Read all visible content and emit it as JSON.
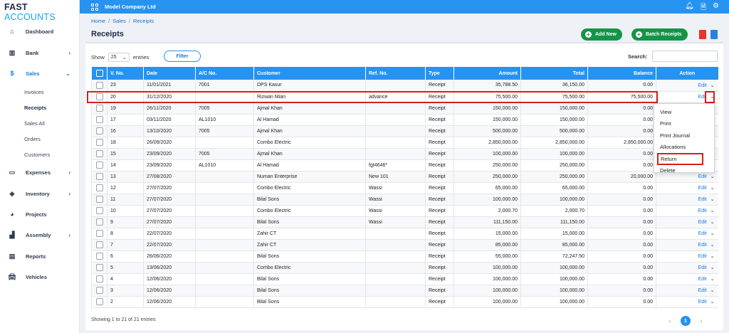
{
  "brand": {
    "part1": "FAST",
    "part2": "ACCOUNTS"
  },
  "topbar": {
    "company": "Model Company Ltd"
  },
  "sidebar": {
    "items": [
      {
        "label": "Dashboard",
        "icon": "home-icon"
      },
      {
        "label": "Bank",
        "icon": "bank-icon"
      },
      {
        "label": "Sales",
        "icon": "dollar-icon"
      },
      {
        "label": "Expenses",
        "icon": "money-icon"
      },
      {
        "label": "Inventory",
        "icon": "cubes-icon"
      },
      {
        "label": "Projects",
        "icon": "pie-chart-icon"
      },
      {
        "label": "Assembly",
        "icon": "bar-chart-icon"
      },
      {
        "label": "Reports",
        "icon": "reports-icon"
      },
      {
        "label": "Vehicles",
        "icon": "car-icon"
      }
    ],
    "sales_sub": [
      "Invoices",
      "Receipts",
      "Sales All",
      "Orders",
      "Customers"
    ]
  },
  "breadcrumb": [
    "Home",
    "Sales",
    "Receipts"
  ],
  "page_title": "Receipts",
  "buttons": {
    "add_new": "Add New",
    "batch_receipts": "Batch Receipts",
    "filter": "Filter"
  },
  "controls": {
    "show": "Show",
    "entries_value": "25",
    "entries": "entries",
    "search": "Search:"
  },
  "table": {
    "headers": [
      "V. No.",
      "Date",
      "A/C No.",
      "Customer",
      "Ref. No.",
      "Type",
      "Amount",
      "Total",
      "Balance",
      "Action"
    ],
    "rows": [
      [
        "23",
        "11/01/2021",
        "7001",
        "DPS Kasur",
        "",
        "Receipt",
        "35,788.50",
        "36,150.00",
        "0.00",
        "edit"
      ],
      [
        "20",
        "31/12/2020",
        "",
        "Rizwan Mian",
        "advance",
        "Receipt",
        "75,500.00",
        "75,500.00",
        "75,500.00",
        "edit"
      ],
      [
        "19",
        "26/11/2020",
        "7005",
        "Ajmal Khan",
        "",
        "Receipt",
        "150,000.00",
        "150,000.00",
        "0.00",
        ""
      ],
      [
        "17",
        "03/11/2020",
        "AL1010",
        "Al Hamad",
        "",
        "Receipt",
        "150,000.00",
        "150,000.00",
        "0.00",
        ""
      ],
      [
        "16",
        "13/10/2020",
        "7005",
        "Ajmal Khan",
        "",
        "Receipt",
        "500,000.00",
        "500,000.00",
        "0.00",
        ""
      ],
      [
        "18",
        "26/09/2020",
        "",
        "Combo Electric",
        "",
        "Receipt",
        "2,850,000.00",
        "2,850,000.00",
        "2,850,000.00",
        ""
      ],
      [
        "15",
        "23/09/2020",
        "7005",
        "Ajmal Khan",
        "",
        "Receipt",
        "100,000.00",
        "100,000.00",
        "0.00",
        ""
      ],
      [
        "14",
        "23/09/2020",
        "AL1010",
        "Al Hamad",
        "fgt4646*",
        "Receipt",
        "250,000.00",
        "250,000.00",
        "0.00",
        ""
      ],
      [
        "13",
        "27/08/2020",
        "",
        "Numan Enterprise",
        "New 101",
        "Receipt",
        "250,000.00",
        "250,000.00",
        "20,000.00",
        "edit"
      ],
      [
        "12",
        "27/07/2020",
        "",
        "Combo Electric",
        "Wassi",
        "Receipt",
        "65,000.00",
        "65,000.00",
        "0.00",
        "edit"
      ],
      [
        "11",
        "27/07/2020",
        "",
        "Bilal Sons",
        "Wassi",
        "Receipt",
        "100,000.00",
        "100,000.00",
        "0.00",
        "edit"
      ],
      [
        "10",
        "27/07/2020",
        "",
        "Combo Electric",
        "Wassi",
        "Receipt",
        "2,000.70",
        "2,000.70",
        "0.00",
        "edit"
      ],
      [
        "9",
        "27/07/2020",
        "",
        "Bilal Sons",
        "Wassi",
        "Receipt",
        "111,150.00",
        "111,150.00",
        "0.00",
        "edit"
      ],
      [
        "8",
        "22/07/2020",
        "",
        "Zahir CT",
        "",
        "Receipt",
        "15,000.00",
        "15,000.00",
        "0.00",
        "edit"
      ],
      [
        "7",
        "22/07/2020",
        "",
        "Zahir CT",
        "",
        "Receipt",
        "85,000.00",
        "85,000.00",
        "0.00",
        "edit"
      ],
      [
        "6",
        "26/06/2020",
        "",
        "Bilal Sons",
        "",
        "Receipt",
        "55,000.00",
        "72,247.50",
        "0.00",
        "edit"
      ],
      [
        "5",
        "13/06/2020",
        "",
        "Combo Electric",
        "",
        "Receipt",
        "100,000.00",
        "100,000.00",
        "0.00",
        "edit"
      ],
      [
        "4",
        "12/06/2020",
        "",
        "Bilal Sons",
        "",
        "Receipt",
        "100,000.00",
        "100,000.00",
        "0.00",
        "edit"
      ],
      [
        "3",
        "12/06/2020",
        "",
        "Bilal Sons",
        "",
        "Receipt",
        "100,000.00",
        "100,000.00",
        "0.00",
        "edit"
      ],
      [
        "2",
        "12/06/2020",
        "",
        "Bilal Sons",
        "",
        "Receipt",
        "100,000.00",
        "100,000.00",
        "0.00",
        "edit"
      ]
    ],
    "edit_label": "Edit"
  },
  "dropdown": [
    "View",
    "Print",
    "Print Journal",
    "Allocations",
    "Return",
    "Delete"
  ],
  "footer": {
    "info": "Showing 1 to 21 of 21 entries",
    "page": "1"
  },
  "colors": {
    "primary": "#2693f0",
    "green": "#149447",
    "highlight": "#d32020"
  }
}
